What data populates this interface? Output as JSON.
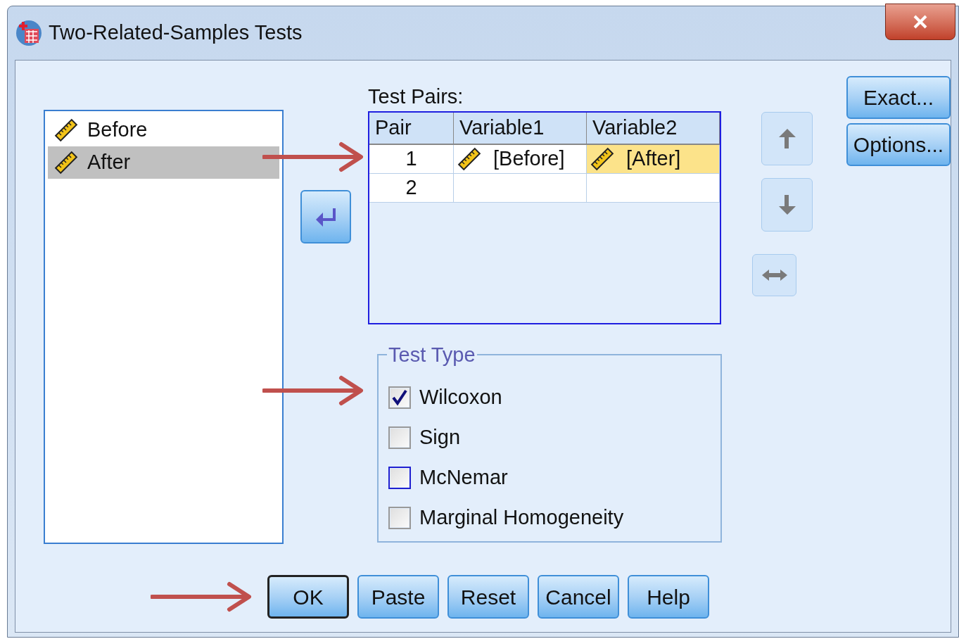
{
  "window": {
    "title": "Two-Related-Samples Tests"
  },
  "variables": [
    {
      "name": "Before",
      "selected": false
    },
    {
      "name": "After",
      "selected": true
    }
  ],
  "test_pairs": {
    "label": "Test Pairs:",
    "columns": [
      "Pair",
      "Variable1",
      "Variable2"
    ],
    "rows": [
      {
        "cells": [
          {
            "kind": "number",
            "text": "1",
            "selected": false
          },
          {
            "kind": "variable",
            "text": "[Before]",
            "selected": false
          },
          {
            "kind": "variable",
            "text": "[After]",
            "selected": true
          }
        ]
      },
      {
        "cells": [
          {
            "kind": "number",
            "text": "2",
            "selected": false
          },
          {
            "kind": "empty",
            "selected": false
          },
          {
            "kind": "empty",
            "selected": false
          }
        ]
      }
    ]
  },
  "side_buttons": [
    "Exact...",
    "Options..."
  ],
  "test_type": {
    "title": "Test Type",
    "options": [
      {
        "label": "Wilcoxon",
        "checked": true,
        "focused": false
      },
      {
        "label": "Sign",
        "checked": false,
        "focused": false
      },
      {
        "label": "McNemar",
        "checked": false,
        "focused": true
      },
      {
        "label": "Marginal Homogeneity",
        "checked": false,
        "focused": false
      }
    ]
  },
  "buttons": [
    {
      "label": "OK",
      "default": true
    },
    {
      "label": "Paste",
      "default": false
    },
    {
      "label": "Reset",
      "default": false
    },
    {
      "label": "Cancel",
      "default": false
    },
    {
      "label": "Help",
      "default": false
    }
  ]
}
